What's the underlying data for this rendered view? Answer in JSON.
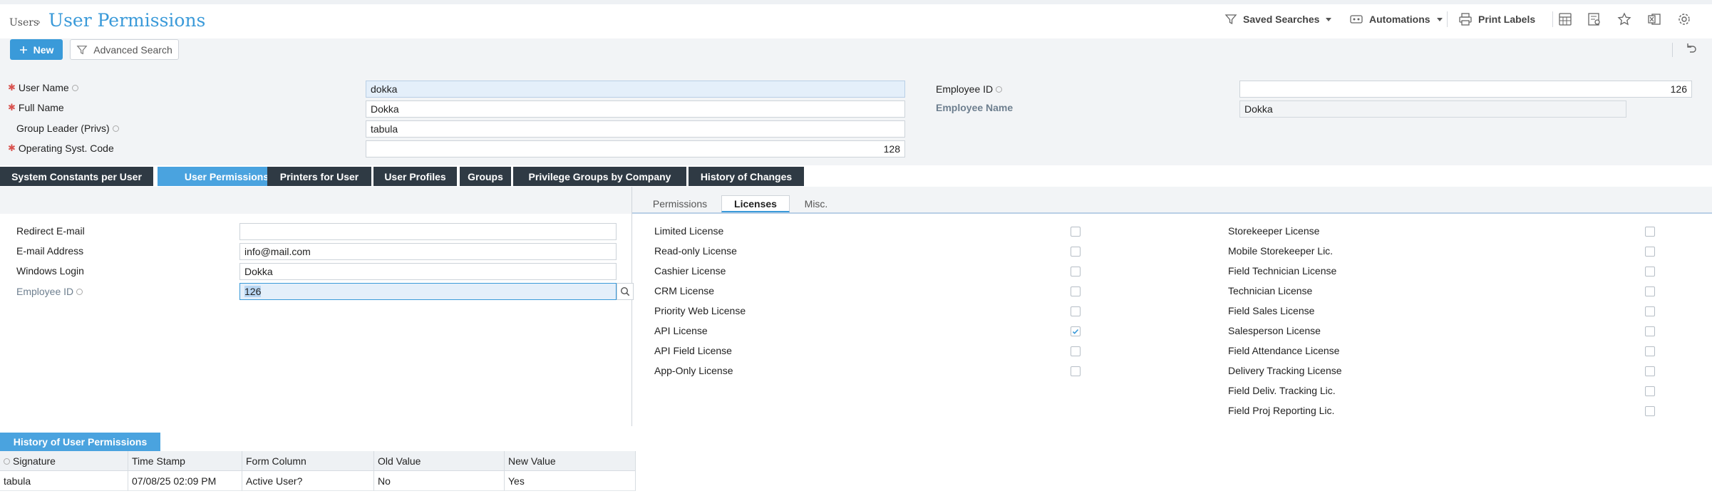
{
  "breadcrumb": {
    "parent": "Users",
    "title": "User Permissions"
  },
  "header": {
    "saved_searches": "Saved Searches",
    "automations": "Automations",
    "print_labels": "Print Labels",
    "icons": [
      "calculator-icon",
      "report-icon",
      "star-icon",
      "excel-icon",
      "settings-icon"
    ]
  },
  "toolbar": {
    "new_label": "New",
    "advanced_search_label": "Advanced Search"
  },
  "form": {
    "user_name_label": "User Name",
    "user_name": "dokka",
    "full_name_label": "Full Name",
    "full_name": "Dokka",
    "group_leader_label": "Group Leader (Privs)",
    "group_leader": "tabula",
    "os_code_label": "Operating Syst. Code",
    "os_code": "128",
    "employee_id_label": "Employee ID",
    "employee_id": "126",
    "employee_name_label": "Employee Name",
    "employee_name": "Dokka"
  },
  "tabs": [
    "System Constants per User",
    "User Permissions",
    "Printers for User",
    "User Profiles",
    "Groups",
    "Privilege Groups by Company",
    "History of Changes"
  ],
  "left_panel": {
    "redirect_email_label": "Redirect E-mail",
    "redirect_email": "",
    "email_label": "E-mail Address",
    "email": "info@mail.com",
    "windows_login_label": "Windows Login",
    "windows_login": "Dokka",
    "employee_id_label": "Employee ID",
    "employee_id": "126"
  },
  "subtabs": [
    "Permissions",
    "Licenses",
    "Misc."
  ],
  "licenses_col1": [
    {
      "label": "Limited License",
      "checked": false
    },
    {
      "label": "Read-only License",
      "checked": false
    },
    {
      "label": "Cashier License",
      "checked": false
    },
    {
      "label": "CRM License",
      "checked": false
    },
    {
      "label": "Priority Web License",
      "checked": false
    },
    {
      "label": "API License",
      "checked": true
    },
    {
      "label": "API Field License",
      "checked": false
    },
    {
      "label": "App-Only License",
      "checked": false
    }
  ],
  "licenses_col2": [
    {
      "label": "Storekeeper License",
      "checked": false
    },
    {
      "label": "Mobile Storekeeper Lic.",
      "checked": false
    },
    {
      "label": "Field Technician License",
      "checked": false
    },
    {
      "label": "Technician License",
      "checked": false
    },
    {
      "label": "Field Sales License",
      "checked": false
    },
    {
      "label": "Salesperson License",
      "checked": false
    },
    {
      "label": "Field Attendance License",
      "checked": false
    },
    {
      "label": "Delivery Tracking License",
      "checked": false
    },
    {
      "label": "Field Deliv. Tracking Lic.",
      "checked": false
    },
    {
      "label": "Field Proj Reporting Lic.",
      "checked": false
    }
  ],
  "history": {
    "tab_label": "History of User Permissions",
    "columns": [
      "Signature",
      "Time Stamp",
      "Form Column",
      "Old Value",
      "New Value"
    ],
    "rows": [
      [
        "tabula",
        "07/08/25 02:09 PM",
        "Active User?",
        "No",
        "Yes"
      ]
    ]
  },
  "colors": {
    "accent": "#3a9ad9",
    "tab_dark": "#2f3a44",
    "required": "#d9534f"
  }
}
